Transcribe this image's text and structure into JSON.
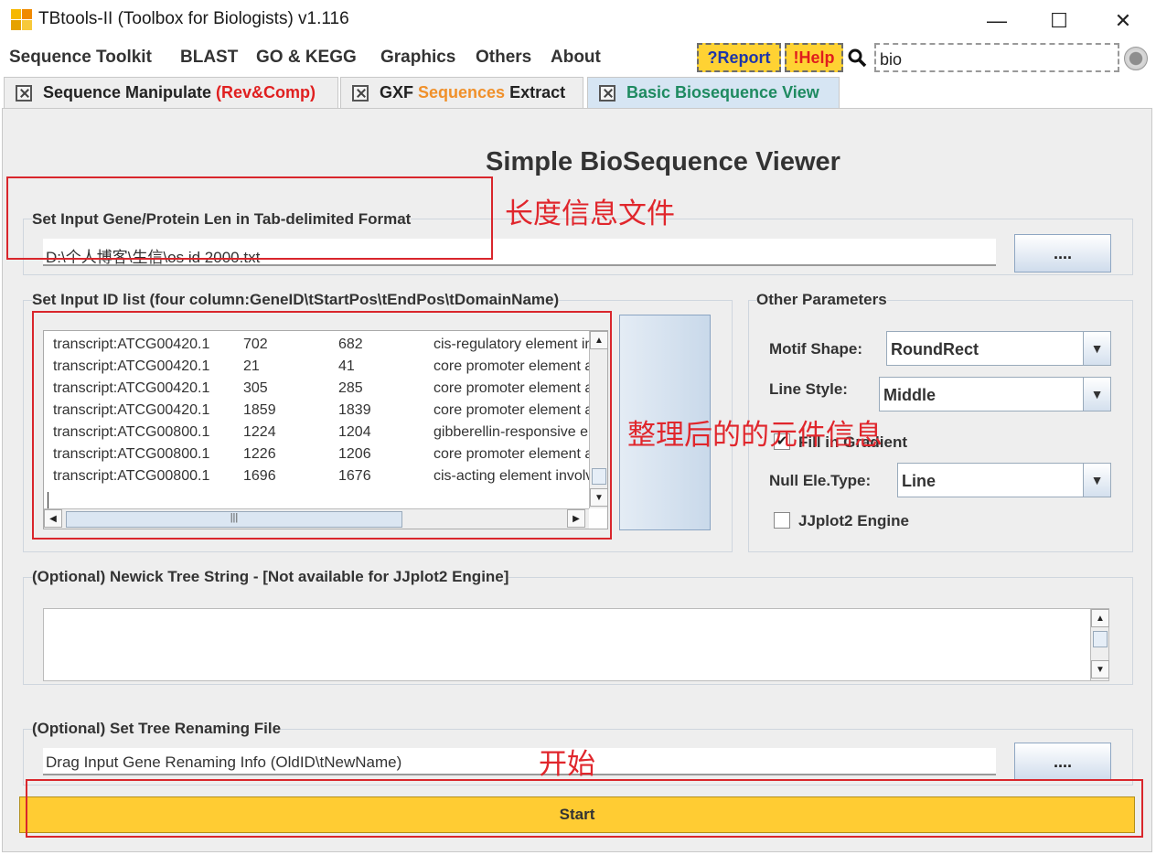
{
  "window": {
    "title": "TBtools-II (Toolbox for Biologists) v1.116",
    "minimize_glyph": "—",
    "maximize_glyph": "☐",
    "close_glyph": "✕"
  },
  "menu": {
    "items": [
      "Sequence Toolkit",
      "BLAST",
      "GO & KEGG",
      "Graphics",
      "Others",
      "About"
    ],
    "report_label": "?Report",
    "help_label": "!Help",
    "search_value": "bio"
  },
  "tabs": [
    {
      "pre": "Sequence Manipulate ",
      "accent": "(Rev&Comp)",
      "post": "",
      "accent_color": "#e02020"
    },
    {
      "pre": "GXF ",
      "accent": "Sequences",
      "post": " Extract",
      "accent_color": "#f0902a"
    },
    {
      "pre": "",
      "accent": "Basic Biosequence View",
      "post": "",
      "accent_color": "#1e8a60"
    }
  ],
  "page": {
    "title": "Simple BioSequence Viewer"
  },
  "len_section": {
    "label": "Set Input Gene/Protein Len in Tab-delimited Format",
    "value": "D:\\个人博客\\生信\\os id 2000.txt",
    "browse_label": "...."
  },
  "id_section": {
    "label": "Set Input ID list (four column:GeneID\\tStartPos\\tEndPos\\tDomainName)",
    "rows": [
      [
        "transcript:ATCG00420.1",
        "702",
        "682",
        "cis-regulatory element in"
      ],
      [
        "transcript:ATCG00420.1",
        "21",
        "41",
        "core promoter element a"
      ],
      [
        "transcript:ATCG00420.1",
        "305",
        "285",
        "core promoter element a"
      ],
      [
        "transcript:ATCG00420.1",
        "1859",
        "1839",
        "core promoter element a"
      ],
      [
        "transcript:ATCG00800.1",
        "1224",
        "1204",
        "gibberellin-responsive el"
      ],
      [
        "transcript:ATCG00800.1",
        "1226",
        "1206",
        "core promoter element a"
      ],
      [
        "transcript:ATCG00800.1",
        "1696",
        "1676",
        "cis-acting element involv"
      ]
    ],
    "hscroll_grip": "|||"
  },
  "params": {
    "label": "Other Parameters",
    "motif_shape_label": "Motif Shape:",
    "motif_shape_value": "RoundRect",
    "line_style_label": "Line Style:",
    "line_style_value": "Middle",
    "fill_gradient_label": "Fill in Gradient",
    "fill_gradient_checked": true,
    "null_type_label": "Null Ele.Type:",
    "null_type_value": "Line",
    "jjplot_label": "JJplot2 Engine",
    "jjplot_checked": false,
    "check_glyph": "✔",
    "dropdown_glyph": "▼"
  },
  "tree_section": {
    "label": "(Optional) Newick Tree String - [Not available for JJplot2 Engine]"
  },
  "rename_section": {
    "label": "(Optional) Set Tree Renaming File",
    "value": "Drag Input Gene Renaming Info (OldID\\tNewName)",
    "browse_label": "...."
  },
  "start_label": "Start",
  "annotations": {
    "len_file": "长度信息文件",
    "elements": "整理后的的元件信息",
    "start": "开始"
  },
  "colors": {
    "accent_yellow": "#ffcc33",
    "annotation_red": "#d9262c",
    "active_tab": "#d6e5f3"
  }
}
